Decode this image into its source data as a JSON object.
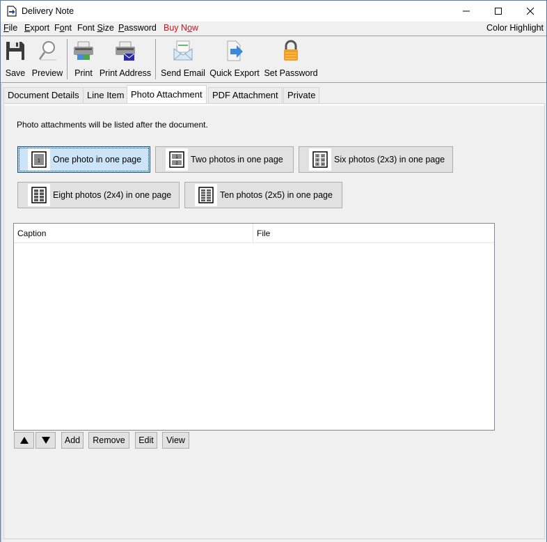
{
  "window": {
    "title": "Delivery Note",
    "controls": [
      "minimize",
      "maximize",
      "close"
    ]
  },
  "menubar": {
    "items": [
      {
        "label": "File",
        "mnemonic_index": 0
      },
      {
        "label": "Export",
        "mnemonic_index": 0
      },
      {
        "label": "Font",
        "mnemonic_index": 1
      },
      {
        "label": "Font Size",
        "mnemonic_index": 5
      },
      {
        "label": "Password",
        "mnemonic_index": 0
      },
      {
        "label": "Buy Now",
        "mnemonic_index": 5,
        "color": "#d4101c"
      }
    ],
    "right_item": "Color Highlight"
  },
  "toolbar": {
    "items": [
      {
        "label": "Save",
        "icon": "floppy-disk-icon"
      },
      {
        "label": "Preview",
        "icon": "magnifier-icon"
      },
      {
        "label": "Print",
        "icon": "printer-icon"
      },
      {
        "label": "Print Address",
        "icon": "printer-envelope-icon"
      },
      {
        "label": "Send Email",
        "icon": "envelope-icon"
      },
      {
        "label": "Quick Export",
        "icon": "export-arrow-icon"
      },
      {
        "label": "Set Password",
        "icon": "padlock-icon"
      }
    ]
  },
  "tabs": [
    {
      "label": "Document Details",
      "active": false
    },
    {
      "label": "Line Item",
      "active": false
    },
    {
      "label": "Photo Attachment",
      "active": true
    },
    {
      "label": "PDF Attachment",
      "active": false
    },
    {
      "label": "Private",
      "active": false
    }
  ],
  "photo_tab": {
    "info_text": "Photo attachments will be listed after the document.",
    "layout_options": [
      {
        "label": "One photo in one page",
        "selected": true,
        "cells": [
          "1"
        ]
      },
      {
        "label": "Two photos in one page",
        "selected": false,
        "cells": [
          "1",
          "2"
        ]
      },
      {
        "label": "Six photos (2x3) in one page",
        "selected": false,
        "cells": [
          "1",
          "2",
          "3",
          "4",
          "5",
          "6"
        ]
      },
      {
        "label": "Eight photos (2x4) in one page",
        "selected": false
      },
      {
        "label": "Ten photos (2x5) in one page",
        "selected": false
      }
    ],
    "table": {
      "columns": [
        "Caption",
        "File"
      ],
      "rows": []
    },
    "actions": {
      "move_up": "▲",
      "move_down": "▼",
      "add": "Add",
      "remove": "Remove",
      "edit": "Edit",
      "view": "View"
    }
  }
}
